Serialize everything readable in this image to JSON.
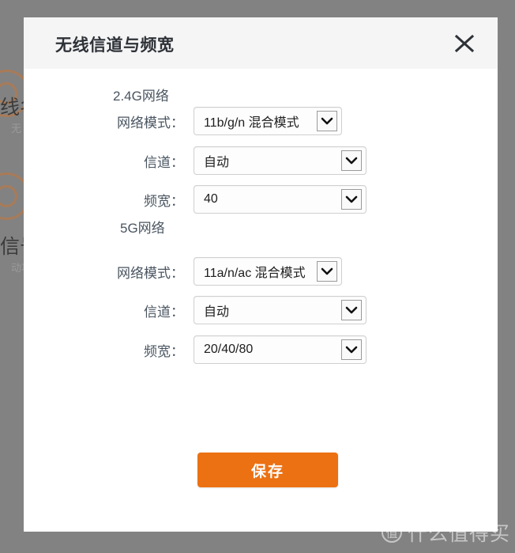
{
  "background": {
    "rows": [
      {
        "main": "线名",
        "sub": "无"
      },
      {
        "main": "信号",
        "sub": "动功"
      }
    ]
  },
  "modal": {
    "title": "无线信道与频宽",
    "close_icon": "close-icon",
    "sections": [
      {
        "heading": "2.4G网络",
        "fields": [
          {
            "label": "网络模式：",
            "value": "11b/g/n 混合模式",
            "width": "narrow"
          },
          {
            "label": "信道：",
            "value": "自动",
            "width": "wide"
          },
          {
            "label": "频宽：",
            "value": "40",
            "width": "wide"
          }
        ]
      },
      {
        "heading": "5G网络",
        "fields": [
          {
            "label": "网络模式：",
            "value": "11a/n/ac 混合模式",
            "width": "narrow"
          },
          {
            "label": "信道：",
            "value": "自动",
            "width": "wide"
          },
          {
            "label": "频宽：",
            "value": "20/40/80",
            "width": "wide"
          }
        ]
      }
    ],
    "save_label": "保存",
    "accent_color": "#ec7112"
  },
  "watermark": {
    "logo_text": "值",
    "text": "什么值得买"
  }
}
